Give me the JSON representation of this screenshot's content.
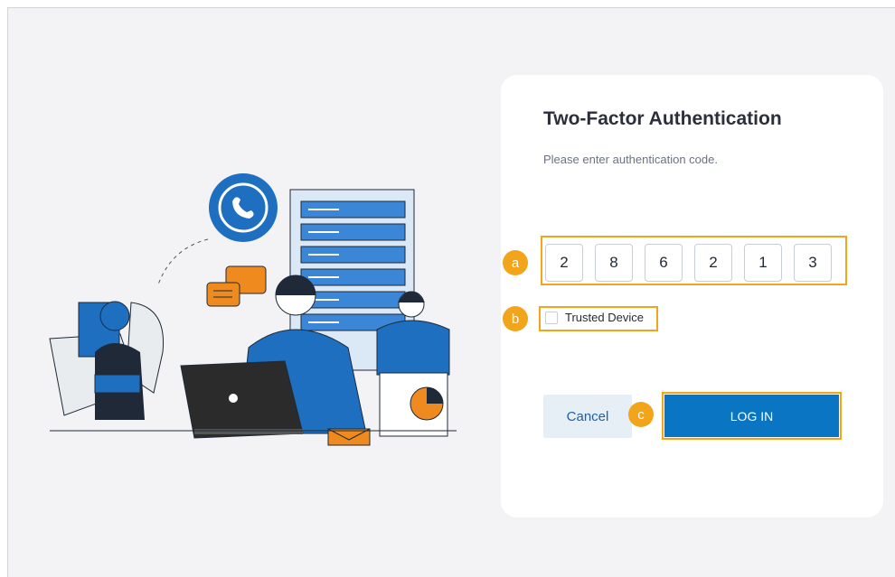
{
  "auth": {
    "title": "Two-Factor Authentication",
    "subtitle": "Please enter authentication code.",
    "code_digits": [
      "2",
      "8",
      "6",
      "2",
      "1",
      "3"
    ],
    "trusted_device_label": "Trusted Device",
    "trusted_device_checked": false,
    "cancel_label": "Cancel",
    "login_label": "LOG IN"
  },
  "annotations": {
    "marker_a": "a",
    "marker_b": "b",
    "marker_c": "c"
  },
  "colors": {
    "highlight": "#f2a51a",
    "primary": "#0a75c2",
    "illustration_blue": "#1e6fc0",
    "illustration_orange": "#ef8a1f"
  },
  "illustration": {
    "icons": [
      "phone-icon",
      "chat-bubble-icon",
      "server-rack-icon",
      "laptop-icon",
      "pie-chart-icon",
      "envelope-icon"
    ]
  }
}
